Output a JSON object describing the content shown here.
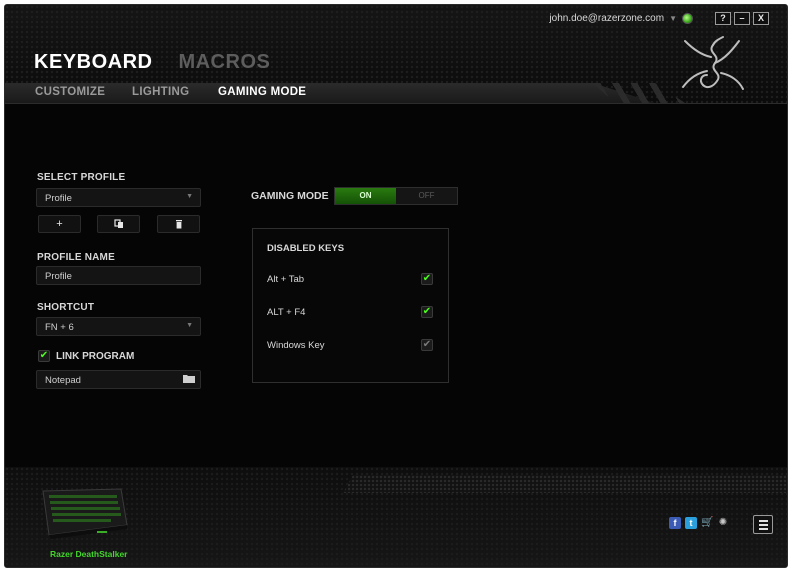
{
  "header": {
    "account_email": "john.doe@razerzone.com",
    "window_buttons": [
      "?",
      "–",
      "X"
    ],
    "main_tabs": [
      {
        "label": "KEYBOARD",
        "active": true
      },
      {
        "label": "MACROS",
        "active": false
      }
    ],
    "sub_tabs": [
      {
        "label": "CUSTOMIZE",
        "active": false
      },
      {
        "label": "LIGHTING",
        "active": false
      },
      {
        "label": "GAMING MODE",
        "active": true
      }
    ]
  },
  "profile": {
    "select_label": "SELECT PROFILE",
    "selected_profile": "Profile",
    "buttons": [
      "+",
      "⧉",
      "🗑"
    ],
    "name_label": "PROFILE NAME",
    "name_value": "Profile",
    "shortcut_label": "SHORTCUT",
    "shortcut_value": "FN + 6",
    "link_program_label": "LINK PROGRAM",
    "link_program_checked": true,
    "program_value": "Notepad"
  },
  "gaming_mode": {
    "label": "GAMING MODE",
    "on_label": "ON",
    "off_label": "OFF",
    "enabled": true,
    "disabled_keys_title": "DISABLED KEYS",
    "keys": [
      {
        "label": "Alt + Tab",
        "checked": true
      },
      {
        "label": "ALT + F4",
        "checked": true
      },
      {
        "label": "Windows Key",
        "checked": true
      }
    ]
  },
  "footer": {
    "device_name": "Razer DeathStalker",
    "social_icons": [
      "facebook-icon",
      "twitter-icon",
      "cart-icon",
      "razer-icon"
    ]
  },
  "colors": {
    "accent": "#44d62c",
    "background": "#050505"
  }
}
